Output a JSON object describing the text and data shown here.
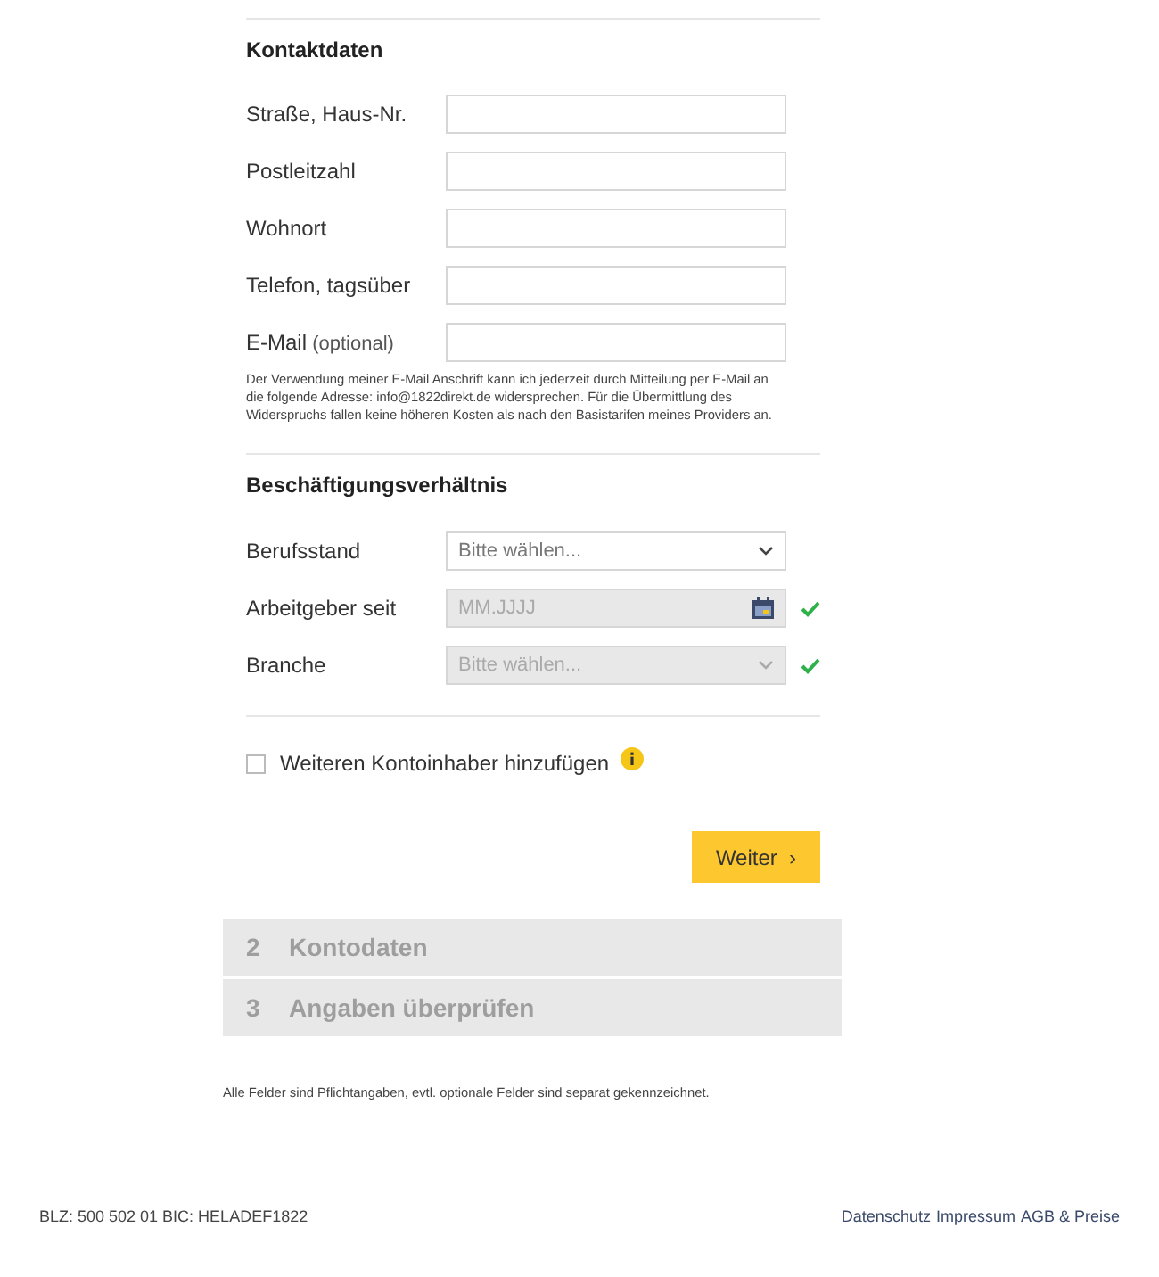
{
  "contact": {
    "heading": "Kontaktdaten",
    "fields": [
      {
        "label": "Straße, Haus-Nr.",
        "kind": "text",
        "disabled": false
      },
      {
        "label": "Postleitzahl",
        "kind": "text",
        "disabled": false
      },
      {
        "label": "Wohnort",
        "kind": "text",
        "disabled": false
      },
      {
        "label": "Telefon, tagsüber",
        "kind": "text",
        "disabled": false
      },
      {
        "label": "E-Mail",
        "note": "(optional)",
        "kind": "text",
        "disabled": false
      }
    ],
    "notice": "Der Verwendung meiner E-Mail Anschrift kann ich jederzeit durch Mitteilung per E-Mail an die folgende Adresse: info@1822direkt.de widersprechen. Für die Übermittlung des Widerspruchs fallen keine höheren Kosten als nach den Basistarifen meines Providers an."
  },
  "employment": {
    "heading": "Beschäftigungsverhältnis",
    "fields": [
      {
        "label": "Berufsstand",
        "kind": "select",
        "placeholder": "Bitte wählen...",
        "disabled": false,
        "valid": false
      },
      {
        "label": "Arbeitgeber seit",
        "kind": "date",
        "placeholder": "MM.JJJJ",
        "disabled": true,
        "valid": true
      },
      {
        "label": "Branche",
        "kind": "select",
        "placeholder": "Bitte wählen...",
        "disabled": true,
        "valid": true
      }
    ]
  },
  "add_holder": {
    "label": "Weiteren Kontoinhaber hinzufügen",
    "checked": false
  },
  "next_button": {
    "label": "Weiter",
    "arrow": "›"
  },
  "steps": [
    {
      "number": "2",
      "label": "Kontodaten"
    },
    {
      "number": "3",
      "label": "Angaben überprüfen"
    }
  ],
  "required_note": "Alle Felder sind Pflichtangaben, evtl. optionale Felder sind separat gekennzeichnet.",
  "footer": {
    "bank_info": "BLZ: 500 502 01 BIC: HELADEF1822",
    "links": [
      "Datenschutz",
      "Impressum",
      "AGB & Preise"
    ]
  }
}
